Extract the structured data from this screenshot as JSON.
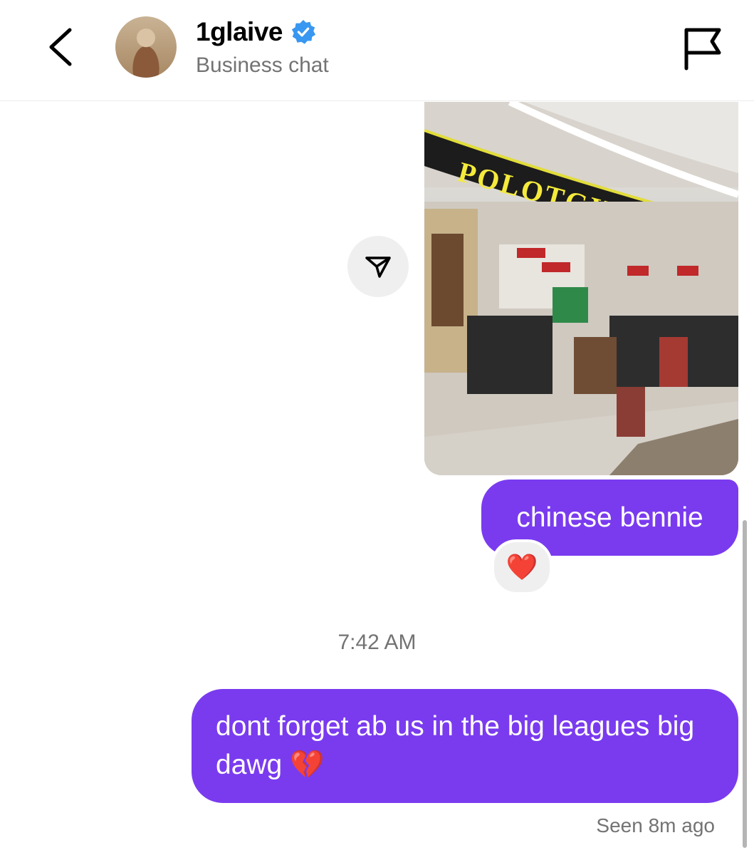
{
  "header": {
    "username": "1glaive",
    "subtitle": "Business chat",
    "back_icon": "chevron-left-icon",
    "verified_icon": "verified-badge-icon",
    "flag_icon": "flag-icon"
  },
  "messages": {
    "image_sign_text": "POLOTGYBPN",
    "share_icon": "share-icon",
    "bubble1_text": "chinese bennie",
    "reaction": "❤️",
    "timestamp": "7:42 AM",
    "bubble2_text": "dont forget ab us in the big leagues big dawg 💔",
    "seen": "Seen 8m ago"
  },
  "colors": {
    "bubble": "#7a3bef",
    "verified": "#3897f0",
    "secondary_text": "#737373"
  }
}
